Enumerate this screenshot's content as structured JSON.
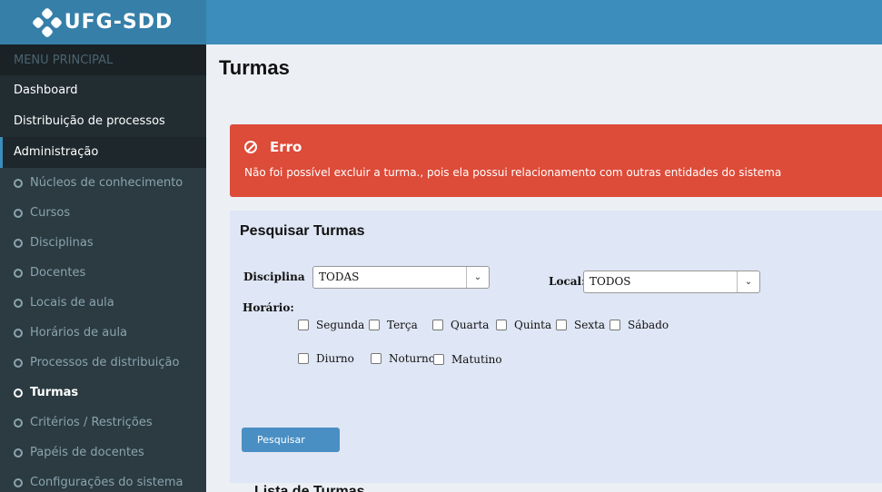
{
  "brand": {
    "name": "UFG-SDD"
  },
  "sidebar": {
    "header": "MENU PRINCIPAL",
    "items": [
      {
        "label": "Dashboard"
      },
      {
        "label": "Distribuição de processos"
      },
      {
        "label": "Administração"
      }
    ],
    "subitems": [
      {
        "label": "Núcleos de conhecimento"
      },
      {
        "label": "Cursos"
      },
      {
        "label": "Disciplinas"
      },
      {
        "label": "Docentes"
      },
      {
        "label": "Locais de aula"
      },
      {
        "label": "Horários de aula"
      },
      {
        "label": "Processos de distribuição"
      },
      {
        "label": "Turmas"
      },
      {
        "label": "Critérios / Restrições"
      },
      {
        "label": "Papéis de docentes"
      },
      {
        "label": "Configurações do sistema"
      }
    ]
  },
  "page": {
    "title": "Turmas"
  },
  "alert": {
    "title": "Erro",
    "message": "Não foi possível excluir a turma., pois ela possui relacionamento com outras entidades do sistema"
  },
  "search": {
    "title": "Pesquisar Turmas",
    "disciplina_label": "Disciplina",
    "disciplina_value": "TODAS",
    "local_label": "Local:",
    "local_value": "TODOS",
    "horario_label": "Horário:",
    "days": [
      {
        "label": "Segunda"
      },
      {
        "label": "Terça"
      },
      {
        "label": "Quarta"
      },
      {
        "label": "Quinta"
      },
      {
        "label": "Sexta"
      },
      {
        "label": "Sábado"
      }
    ],
    "shifts": [
      {
        "label": "Diurno"
      },
      {
        "label": "Noturno"
      },
      {
        "label": "Matutino"
      }
    ],
    "button": "Pesquisar"
  },
  "list": {
    "title": "Lista de Turmas"
  },
  "colors": {
    "header": "#3c8dbc",
    "sidebar": "#222d32",
    "alert": "#dd4b39",
    "button": "#4a8fc4"
  }
}
